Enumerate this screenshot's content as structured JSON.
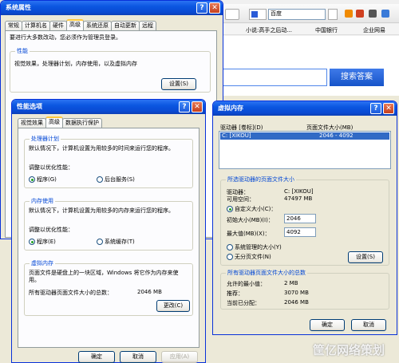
{
  "browser": {
    "search_placeholder": "百度",
    "links": [
      "小说:高手之后动...",
      "中国银行",
      "企业网易"
    ],
    "search_button": "搜索答案"
  },
  "sysprops": {
    "title": "系统属性",
    "tabs": [
      "常规",
      "计算机名",
      "硬件",
      "高级",
      "系统还原",
      "自动更新",
      "远程"
    ],
    "note": "要进行大多数改动，您必须作为管理员登录。",
    "perf_group": "性能",
    "perf_desc": "视觉效果，处理器计划，内存使用，以及虚拟内存",
    "settings_btn": "设置(S)"
  },
  "perf": {
    "title": "性能选项",
    "tabs": [
      "视觉效果",
      "高级",
      "数据执行保护"
    ],
    "cpu_group": "处理器计划",
    "cpu_desc": "默认情况下，计算机设置为用较多的时间来运行您的程序。",
    "cpu_opt": "调整以优化性能：",
    "cpu_r1": "程序(G)",
    "cpu_r2": "后台服务(S)",
    "mem_group": "内存使用",
    "mem_desc": "默认情况下，计算机设置为用较多的内存来运行您的程序。",
    "mem_opt": "调整以优化性能：",
    "mem_r1": "程序(E)",
    "mem_r2": "系统缓存(T)",
    "vm_group": "虚拟内存",
    "vm_desc": "页面文件是硬盘上的一块区域，Windows 将它作为内存来使用。",
    "vm_total_label": "所有驱动器页面文件大小的总数：",
    "vm_total_value": "2046 MB",
    "change_btn": "更改(C)",
    "ok": "确定",
    "cancel": "取消",
    "apply": "应用(A)"
  },
  "vm": {
    "title": "虚拟内存",
    "col_drive": "驱动器 [卷标](D)",
    "col_size": "页面文件大小(MB)",
    "row_drive": "C:   [XIKOU]",
    "row_size": "2046 - 4092",
    "sel_group": "所选驱动器的页面文件大小",
    "drive_label": "驱动器：",
    "drive_value": "C:  [XIKOU]",
    "free_label": "可用空间：",
    "free_value": "47497 MB",
    "custom": "自定义大小(C)：",
    "init_label": "初始大小(MB)(I)：",
    "init_value": "2046",
    "max_label": "最大值(MB)(X)：",
    "max_value": "4092",
    "sys_managed": "系统管理的大小(Y)",
    "no_paging": "无分页文件(N)",
    "set_btn": "设置(S)",
    "total_group": "所有驱动器页面文件大小的总数",
    "min_label": "允许的最小值：",
    "min_value": "2 MB",
    "rec_label": "推荐：",
    "rec_value": "3070 MB",
    "cur_label": "当前已分配：",
    "cur_value": "2046 MB",
    "ok": "确定",
    "cancel": "取消"
  },
  "watermark": "筐亿网络策划"
}
